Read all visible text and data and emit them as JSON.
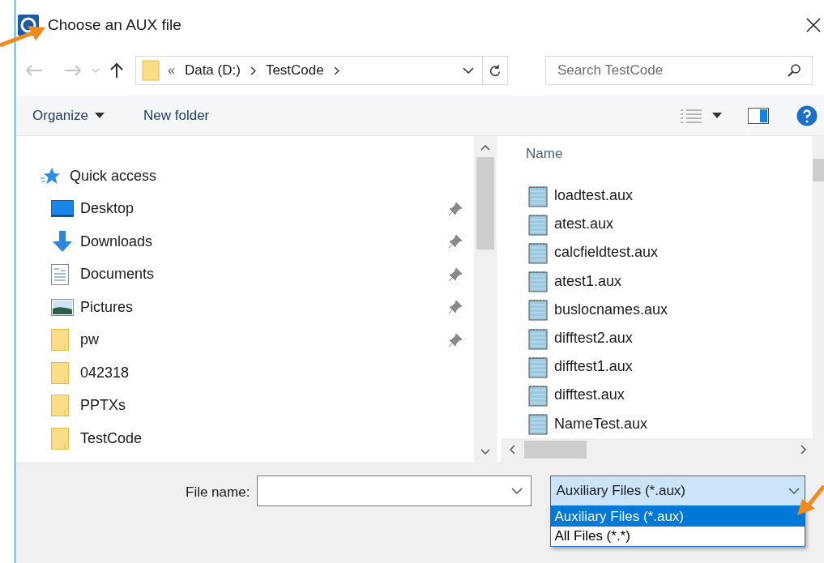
{
  "window": {
    "title": "Choose an AUX file"
  },
  "address_bar": {
    "overflow": "«",
    "segments": [
      "Data (D:)",
      "TestCode"
    ]
  },
  "search": {
    "placeholder": "Search TestCode"
  },
  "toolbar": {
    "items": [
      {
        "label": "Organize",
        "kind": "menu"
      },
      {
        "label": "New folder",
        "kind": "button"
      }
    ]
  },
  "navigation": {
    "items": [
      {
        "label": "Quick access",
        "kind": "quick",
        "pinned": false
      },
      {
        "label": "Desktop",
        "kind": "desktop",
        "pinned": true
      },
      {
        "label": "Downloads",
        "kind": "downloads",
        "pinned": true
      },
      {
        "label": "Documents",
        "kind": "documents",
        "pinned": true
      },
      {
        "label": "Pictures",
        "kind": "pictures",
        "pinned": true
      },
      {
        "label": "pw",
        "kind": "folder",
        "pinned": true
      },
      {
        "label": "042318",
        "kind": "folder",
        "pinned": false
      },
      {
        "label": "PPTXs",
        "kind": "folder",
        "pinned": false
      },
      {
        "label": "TestCode",
        "kind": "folder",
        "pinned": false
      }
    ]
  },
  "files": {
    "column": "Name",
    "items": [
      "loadtest.aux",
      "atest.aux",
      "calcfieldtest.aux",
      "atest1.aux",
      "buslocnames.aux",
      "difftest2.aux",
      "difftest1.aux",
      "difftest.aux",
      "NameTest.aux"
    ]
  },
  "file_name": {
    "label": "File name:"
  },
  "file_type": {
    "value": "Auxiliary Files (*.aux)",
    "expanded": true,
    "options": [
      {
        "label": "Auxiliary Files (*.aux)",
        "selected": true
      },
      {
        "label": "All Files (*.*)",
        "selected": false
      }
    ]
  }
}
